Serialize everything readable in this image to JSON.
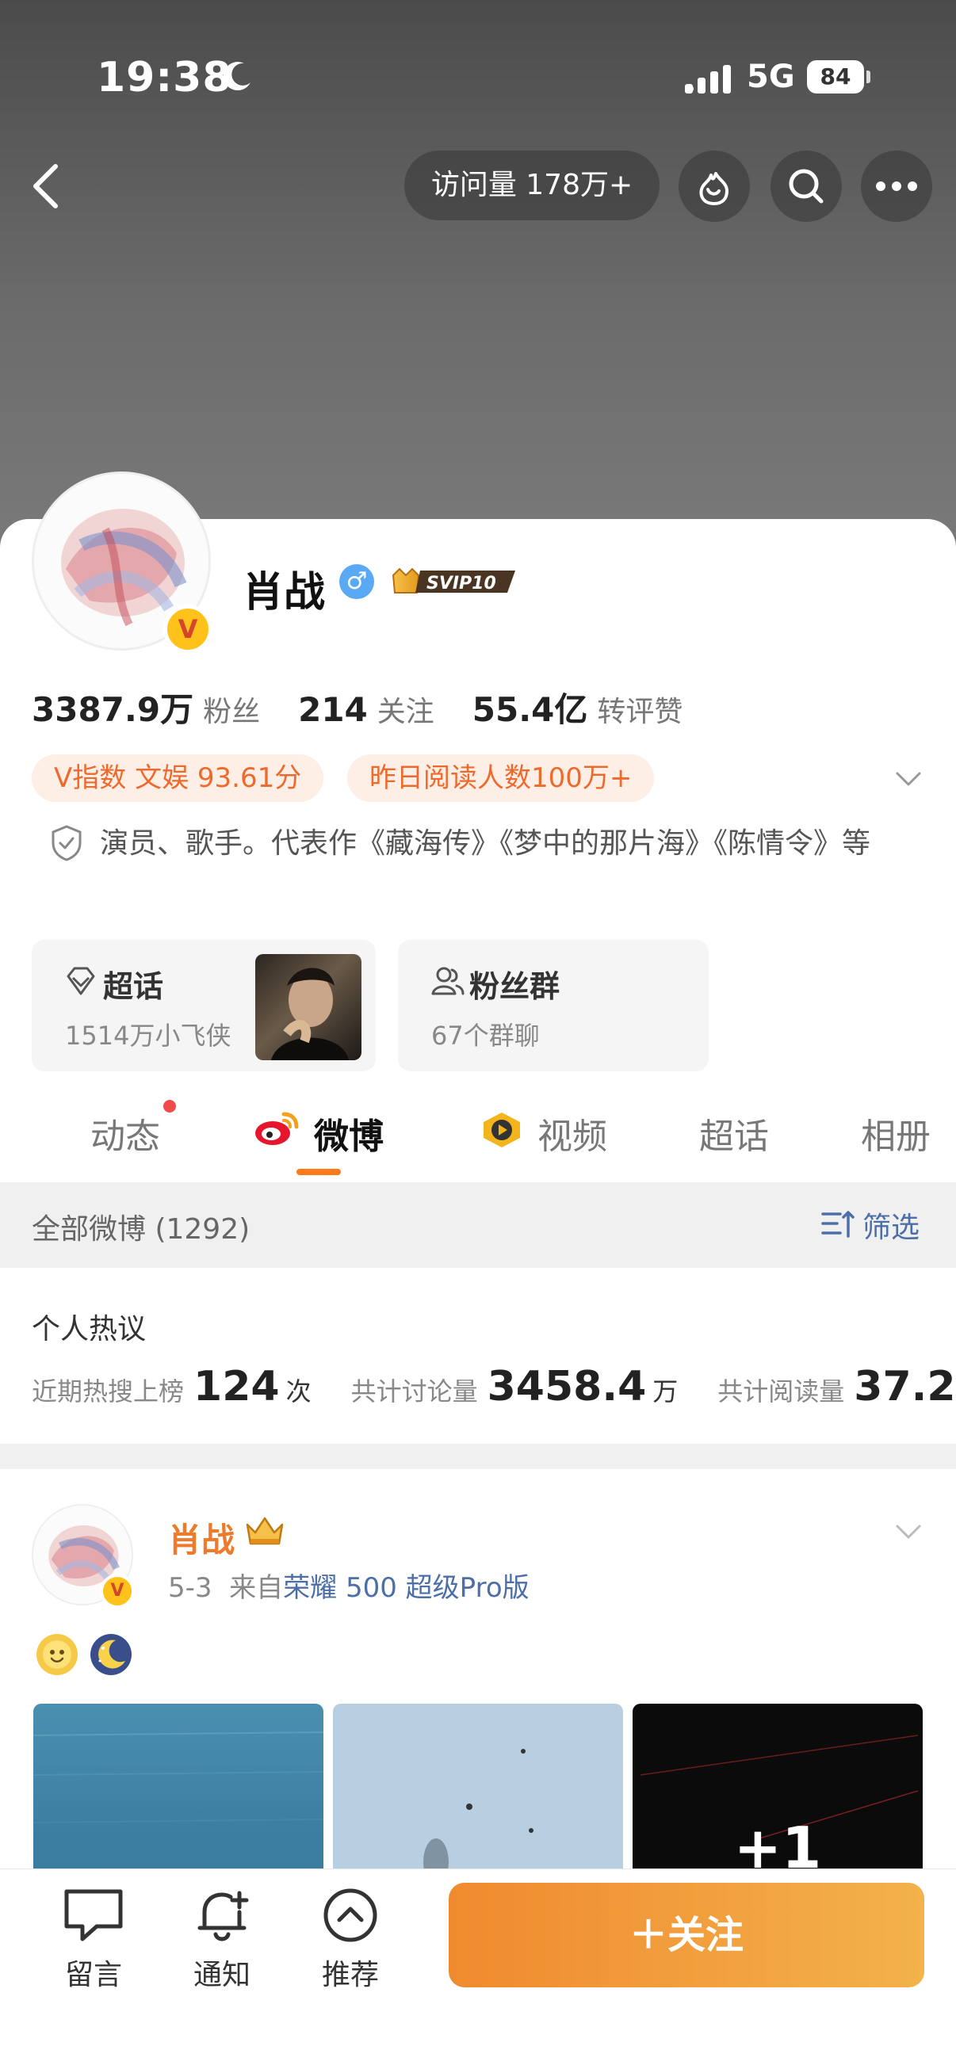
{
  "status_bar": {
    "time": "19:38",
    "network": "5G",
    "battery": "84"
  },
  "top_nav": {
    "visits": "访问量 178万+"
  },
  "profile": {
    "name": "肖战",
    "gender_symbol": "♂",
    "svip_label": "SVIP10",
    "verified_badge": "V",
    "stats": [
      {
        "value": "3387.9万",
        "label": "粉丝"
      },
      {
        "value": "214",
        "label": "关注"
      },
      {
        "value": "55.4亿",
        "label": "转评赞"
      }
    ],
    "tags": [
      "V指数 文娱 93.61分",
      "昨日阅读人数100万+"
    ],
    "bio": "演员、歌手。代表作《藏海传》《梦中的那片海》《陈情令》等"
  },
  "features": {
    "supertopic": {
      "title": "超话",
      "subtitle": "1514万小飞侠"
    },
    "fan_group": {
      "title": "粉丝群",
      "subtitle": "67个群聊"
    }
  },
  "tabs": [
    {
      "label": "动态",
      "active": false
    },
    {
      "label": "微博",
      "active": true
    },
    {
      "label": "视频",
      "active": false
    },
    {
      "label": "超话",
      "active": false
    },
    {
      "label": "相册",
      "active": false
    }
  ],
  "filter": {
    "title": "全部微博 (1292)",
    "button": "筛选"
  },
  "hot_discussion": {
    "title": "个人热议",
    "items": [
      {
        "label": "近期热搜上榜",
        "value": "124",
        "unit": "次"
      },
      {
        "label": "共计讨论量",
        "value": "3458.4",
        "unit": "万"
      },
      {
        "label": "共计阅读量",
        "value": "37.2",
        "unit": ""
      }
    ]
  },
  "post": {
    "author": "肖战",
    "date": "5-3",
    "source_prefix": "来自",
    "source": "荣耀 500 超级Pro版",
    "extra_photos": "+1"
  },
  "bottom_bar": {
    "message": "留言",
    "notify": "通知",
    "recommend": "推荐",
    "follow": "＋关注"
  },
  "colors": {
    "accent": "#ff7a1a",
    "link": "#4b6fa6",
    "follow_start": "#f08a2e",
    "follow_end": "#f3b24a"
  }
}
